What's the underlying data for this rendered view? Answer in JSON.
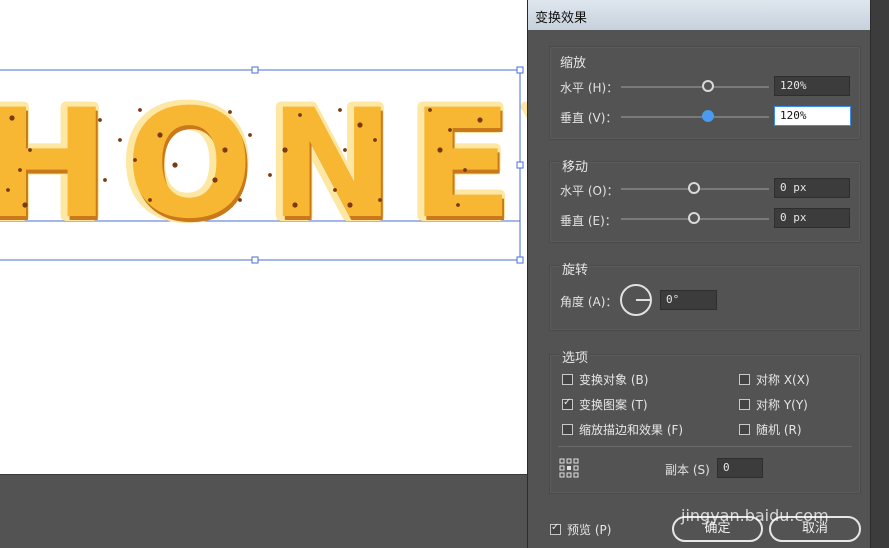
{
  "artwork": {
    "text": "HONEY",
    "fill": "#f7b733",
    "edge": "#c9791b",
    "dot": "#7a3b12",
    "glow": "#fde7a3"
  },
  "dialog": {
    "title": "变换效果",
    "scale": {
      "title": "缩放",
      "horizontal_label": "水平 (H)：",
      "horizontal_value": "120%",
      "vertical_label": "垂直 (V)：",
      "vertical_value": "120%"
    },
    "move": {
      "title": "移动",
      "horizontal_label": "水平 (O)：",
      "horizontal_value": "0 px",
      "vertical_label": "垂直 (E)：",
      "vertical_value": "0 px"
    },
    "rotate": {
      "title": "旋转",
      "angle_label": "角度 (A)：",
      "angle_value": "0°"
    },
    "options": {
      "title": "选项",
      "transform_objects": {
        "label": "变换对象 (B)",
        "checked": false
      },
      "transform_patterns": {
        "label": "变换图案 (T)",
        "checked": true
      },
      "scale_strokes": {
        "label": "缩放描边和效果 (F)",
        "checked": false
      },
      "reflect_x": {
        "label": "对称 X(X)",
        "checked": false
      },
      "reflect_y": {
        "label": "对称 Y(Y)",
        "checked": false
      },
      "random": {
        "label": "随机 (R)",
        "checked": false
      }
    },
    "copies": {
      "label": "副本 (S)",
      "value": "0"
    },
    "preview": {
      "label": "预览 (P)",
      "checked": true
    },
    "ok_label": "确定",
    "cancel_label": "取消"
  },
  "watermark": "jingyan.baidu.com"
}
